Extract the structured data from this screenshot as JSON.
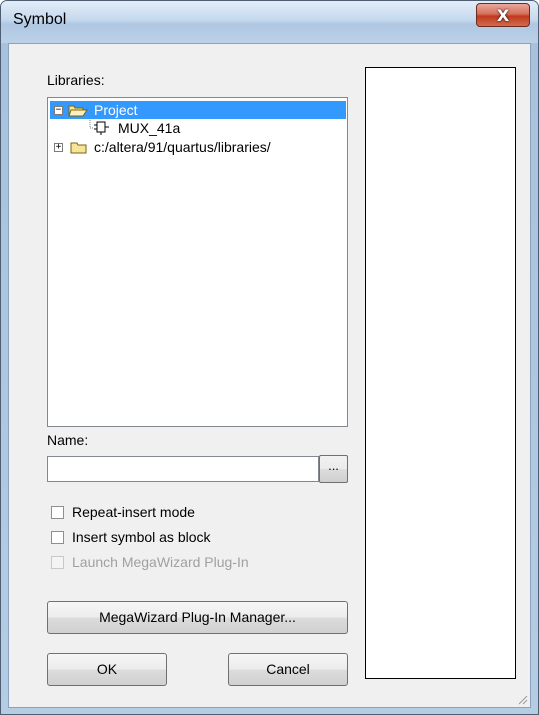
{
  "window": {
    "title": "Symbol",
    "close_glyph": "X"
  },
  "libraries": {
    "label": "Libraries:",
    "items": [
      {
        "label": "Project",
        "expander": "−",
        "selected": true
      },
      {
        "label": "MUX_41a"
      },
      {
        "label": "c:/altera/91/quartus/libraries/",
        "expander": "+"
      }
    ]
  },
  "name": {
    "label": "Name:",
    "value": "",
    "browse_label": "..."
  },
  "options": {
    "repeat_insert": "Repeat-insert mode",
    "insert_as_block": "Insert symbol as block",
    "launch_megawizard": "Launch MegaWizard Plug-In"
  },
  "buttons": {
    "megawizard_manager": "MegaWizard Plug-In Manager...",
    "ok": "OK",
    "cancel": "Cancel"
  },
  "colors": {
    "selection": "#3399ff",
    "close": "#c0391f"
  },
  "icons": [
    "open-folder-icon",
    "symbol-icon",
    "folder-icon",
    "close-icon",
    "resize-grip-icon"
  ]
}
